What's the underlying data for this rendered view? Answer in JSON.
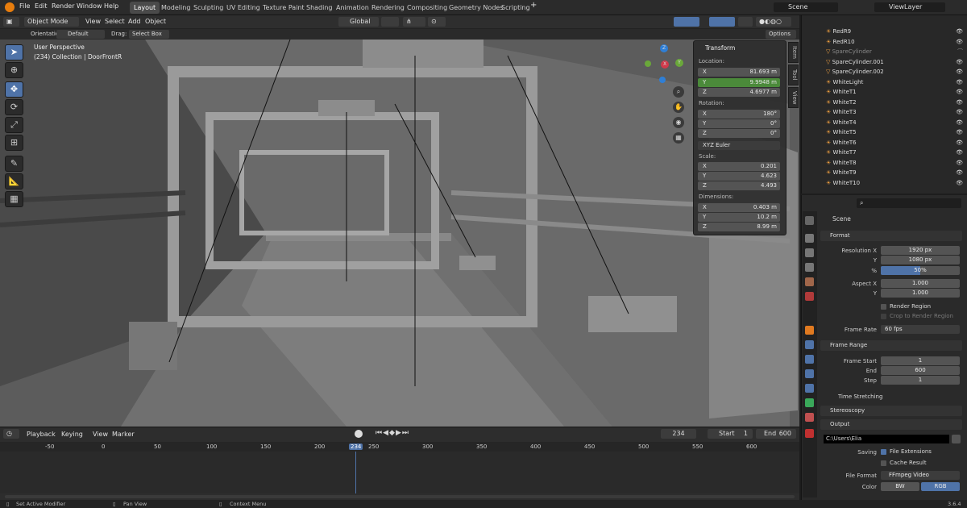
{
  "topbar": {
    "menus": [
      "File",
      "Edit",
      "Render",
      "Window",
      "Help"
    ],
    "workspaces": [
      "Layout",
      "Modeling",
      "Sculpting",
      "UV Editing",
      "Texture Paint",
      "Shading",
      "Animation",
      "Rendering",
      "Compositing",
      "Geometry Nodes",
      "Scripting"
    ],
    "plus": "+",
    "scene": "Scene",
    "viewlayer": "ViewLayer"
  },
  "header": {
    "mode": "Object Mode",
    "menus": [
      "View",
      "Select",
      "Add",
      "Object"
    ],
    "transform": "Global",
    "orientation_label": "Orientation:",
    "orientation_value": "Default",
    "drag_label": "Drag:",
    "drag_value": "Select Box",
    "options": "Options"
  },
  "viewport": {
    "perspective": "User Perspective",
    "collection": "(234) Collection | DoorFrontR"
  },
  "npanel": {
    "title": "Transform",
    "location_label": "Location:",
    "loc": [
      {
        "axis": "X",
        "value": "81.693 m"
      },
      {
        "axis": "Y",
        "value": "9.9948 m"
      },
      {
        "axis": "Z",
        "value": "4.6977 m"
      }
    ],
    "rotation_label": "Rotation:",
    "rot": [
      {
        "axis": "X",
        "value": "180°"
      },
      {
        "axis": "Y",
        "value": "0°"
      },
      {
        "axis": "Z",
        "value": "0°"
      }
    ],
    "rotation_mode": "XYZ Euler",
    "scale_label": "Scale:",
    "scale": [
      {
        "axis": "X",
        "value": "0.201"
      },
      {
        "axis": "Y",
        "value": "4.623"
      },
      {
        "axis": "Z",
        "value": "4.493"
      }
    ],
    "dimensions_label": "Dimensions:",
    "dims": [
      {
        "axis": "X",
        "value": "0.403 m"
      },
      {
        "axis": "Y",
        "value": "10.2 m"
      },
      {
        "axis": "Z",
        "value": "8.99 m"
      }
    ]
  },
  "sidetabs": [
    "Item",
    "Tool",
    "View"
  ],
  "outliner": {
    "items": [
      "RedR9",
      "RedR10",
      "SpareCylinder",
      "SpareCylinder.001",
      "SpareCylinder.002",
      "WhiteLight",
      "WhiteT1",
      "WhiteT2",
      "WhiteT3",
      "WhiteT4",
      "WhiteT5",
      "WhiteT6",
      "WhiteT7",
      "WhiteT8",
      "WhiteT9",
      "WhiteT10"
    ]
  },
  "properties": {
    "scene": "Scene",
    "format": {
      "title": "Format",
      "res_x_label": "Resolution X",
      "res_x": "1920 px",
      "res_y_label": "Y",
      "res_y": "1080 px",
      "pct_label": "%",
      "pct": "50%",
      "pct_fill": 0.5,
      "aspect_x_label": "Aspect X",
      "aspect_x": "1.000",
      "aspect_y_label": "Y",
      "aspect_y": "1.000",
      "render_region": "Render Region",
      "crop": "Crop to Render Region",
      "frame_rate_label": "Frame Rate",
      "frame_rate": "60 fps"
    },
    "frame_range": {
      "title": "Frame Range",
      "start_label": "Frame Start",
      "start": "1",
      "end_label": "End",
      "end": "600",
      "step_label": "Step",
      "step": "1",
      "time_stretching": "Time Stretching"
    },
    "stereoscopy": "Stereoscopy",
    "output": {
      "title": "Output",
      "path": "C:\\Users\\Elia",
      "saving_label": "Saving",
      "file_ext": "File Extensions",
      "cache": "Cache Result",
      "file_format_label": "File Format",
      "file_format": "FFmpeg Video",
      "color_label": "Color",
      "bw": "BW",
      "rgb": "RGB"
    }
  },
  "timeline": {
    "menus": [
      "Playback",
      "Keying",
      "View",
      "Marker"
    ],
    "current": "234",
    "start_label": "Start",
    "start": "1",
    "end_label": "End",
    "end": "600",
    "ticks": [
      "-50",
      "0",
      "50",
      "100",
      "150",
      "200",
      "234",
      "250",
      "300",
      "350",
      "400",
      "450",
      "500",
      "550",
      "600"
    ]
  },
  "status": {
    "left": "Set Active Modifier",
    "mid": "Pan View",
    "right": "Context Menu",
    "version": "3.6.4"
  }
}
